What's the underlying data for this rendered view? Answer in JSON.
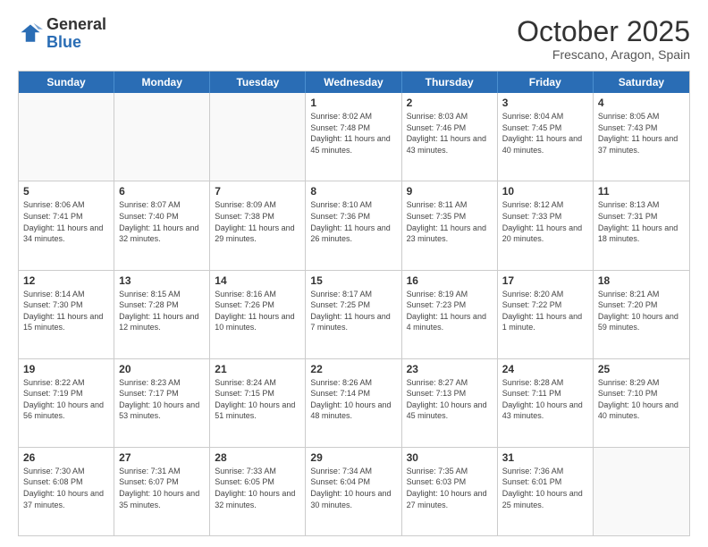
{
  "logo": {
    "general": "General",
    "blue": "Blue"
  },
  "header": {
    "month": "October 2025",
    "location": "Frescano, Aragon, Spain"
  },
  "weekdays": [
    "Sunday",
    "Monday",
    "Tuesday",
    "Wednesday",
    "Thursday",
    "Friday",
    "Saturday"
  ],
  "weeks": [
    [
      {
        "day": "",
        "info": ""
      },
      {
        "day": "",
        "info": ""
      },
      {
        "day": "",
        "info": ""
      },
      {
        "day": "1",
        "info": "Sunrise: 8:02 AM\nSunset: 7:48 PM\nDaylight: 11 hours and 45 minutes."
      },
      {
        "day": "2",
        "info": "Sunrise: 8:03 AM\nSunset: 7:46 PM\nDaylight: 11 hours and 43 minutes."
      },
      {
        "day": "3",
        "info": "Sunrise: 8:04 AM\nSunset: 7:45 PM\nDaylight: 11 hours and 40 minutes."
      },
      {
        "day": "4",
        "info": "Sunrise: 8:05 AM\nSunset: 7:43 PM\nDaylight: 11 hours and 37 minutes."
      }
    ],
    [
      {
        "day": "5",
        "info": "Sunrise: 8:06 AM\nSunset: 7:41 PM\nDaylight: 11 hours and 34 minutes."
      },
      {
        "day": "6",
        "info": "Sunrise: 8:07 AM\nSunset: 7:40 PM\nDaylight: 11 hours and 32 minutes."
      },
      {
        "day": "7",
        "info": "Sunrise: 8:09 AM\nSunset: 7:38 PM\nDaylight: 11 hours and 29 minutes."
      },
      {
        "day": "8",
        "info": "Sunrise: 8:10 AM\nSunset: 7:36 PM\nDaylight: 11 hours and 26 minutes."
      },
      {
        "day": "9",
        "info": "Sunrise: 8:11 AM\nSunset: 7:35 PM\nDaylight: 11 hours and 23 minutes."
      },
      {
        "day": "10",
        "info": "Sunrise: 8:12 AM\nSunset: 7:33 PM\nDaylight: 11 hours and 20 minutes."
      },
      {
        "day": "11",
        "info": "Sunrise: 8:13 AM\nSunset: 7:31 PM\nDaylight: 11 hours and 18 minutes."
      }
    ],
    [
      {
        "day": "12",
        "info": "Sunrise: 8:14 AM\nSunset: 7:30 PM\nDaylight: 11 hours and 15 minutes."
      },
      {
        "day": "13",
        "info": "Sunrise: 8:15 AM\nSunset: 7:28 PM\nDaylight: 11 hours and 12 minutes."
      },
      {
        "day": "14",
        "info": "Sunrise: 8:16 AM\nSunset: 7:26 PM\nDaylight: 11 hours and 10 minutes."
      },
      {
        "day": "15",
        "info": "Sunrise: 8:17 AM\nSunset: 7:25 PM\nDaylight: 11 hours and 7 minutes."
      },
      {
        "day": "16",
        "info": "Sunrise: 8:19 AM\nSunset: 7:23 PM\nDaylight: 11 hours and 4 minutes."
      },
      {
        "day": "17",
        "info": "Sunrise: 8:20 AM\nSunset: 7:22 PM\nDaylight: 11 hours and 1 minute."
      },
      {
        "day": "18",
        "info": "Sunrise: 8:21 AM\nSunset: 7:20 PM\nDaylight: 10 hours and 59 minutes."
      }
    ],
    [
      {
        "day": "19",
        "info": "Sunrise: 8:22 AM\nSunset: 7:19 PM\nDaylight: 10 hours and 56 minutes."
      },
      {
        "day": "20",
        "info": "Sunrise: 8:23 AM\nSunset: 7:17 PM\nDaylight: 10 hours and 53 minutes."
      },
      {
        "day": "21",
        "info": "Sunrise: 8:24 AM\nSunset: 7:15 PM\nDaylight: 10 hours and 51 minutes."
      },
      {
        "day": "22",
        "info": "Sunrise: 8:26 AM\nSunset: 7:14 PM\nDaylight: 10 hours and 48 minutes."
      },
      {
        "day": "23",
        "info": "Sunrise: 8:27 AM\nSunset: 7:13 PM\nDaylight: 10 hours and 45 minutes."
      },
      {
        "day": "24",
        "info": "Sunrise: 8:28 AM\nSunset: 7:11 PM\nDaylight: 10 hours and 43 minutes."
      },
      {
        "day": "25",
        "info": "Sunrise: 8:29 AM\nSunset: 7:10 PM\nDaylight: 10 hours and 40 minutes."
      }
    ],
    [
      {
        "day": "26",
        "info": "Sunrise: 7:30 AM\nSunset: 6:08 PM\nDaylight: 10 hours and 37 minutes."
      },
      {
        "day": "27",
        "info": "Sunrise: 7:31 AM\nSunset: 6:07 PM\nDaylight: 10 hours and 35 minutes."
      },
      {
        "day": "28",
        "info": "Sunrise: 7:33 AM\nSunset: 6:05 PM\nDaylight: 10 hours and 32 minutes."
      },
      {
        "day": "29",
        "info": "Sunrise: 7:34 AM\nSunset: 6:04 PM\nDaylight: 10 hours and 30 minutes."
      },
      {
        "day": "30",
        "info": "Sunrise: 7:35 AM\nSunset: 6:03 PM\nDaylight: 10 hours and 27 minutes."
      },
      {
        "day": "31",
        "info": "Sunrise: 7:36 AM\nSunset: 6:01 PM\nDaylight: 10 hours and 25 minutes."
      },
      {
        "day": "",
        "info": ""
      }
    ]
  ]
}
